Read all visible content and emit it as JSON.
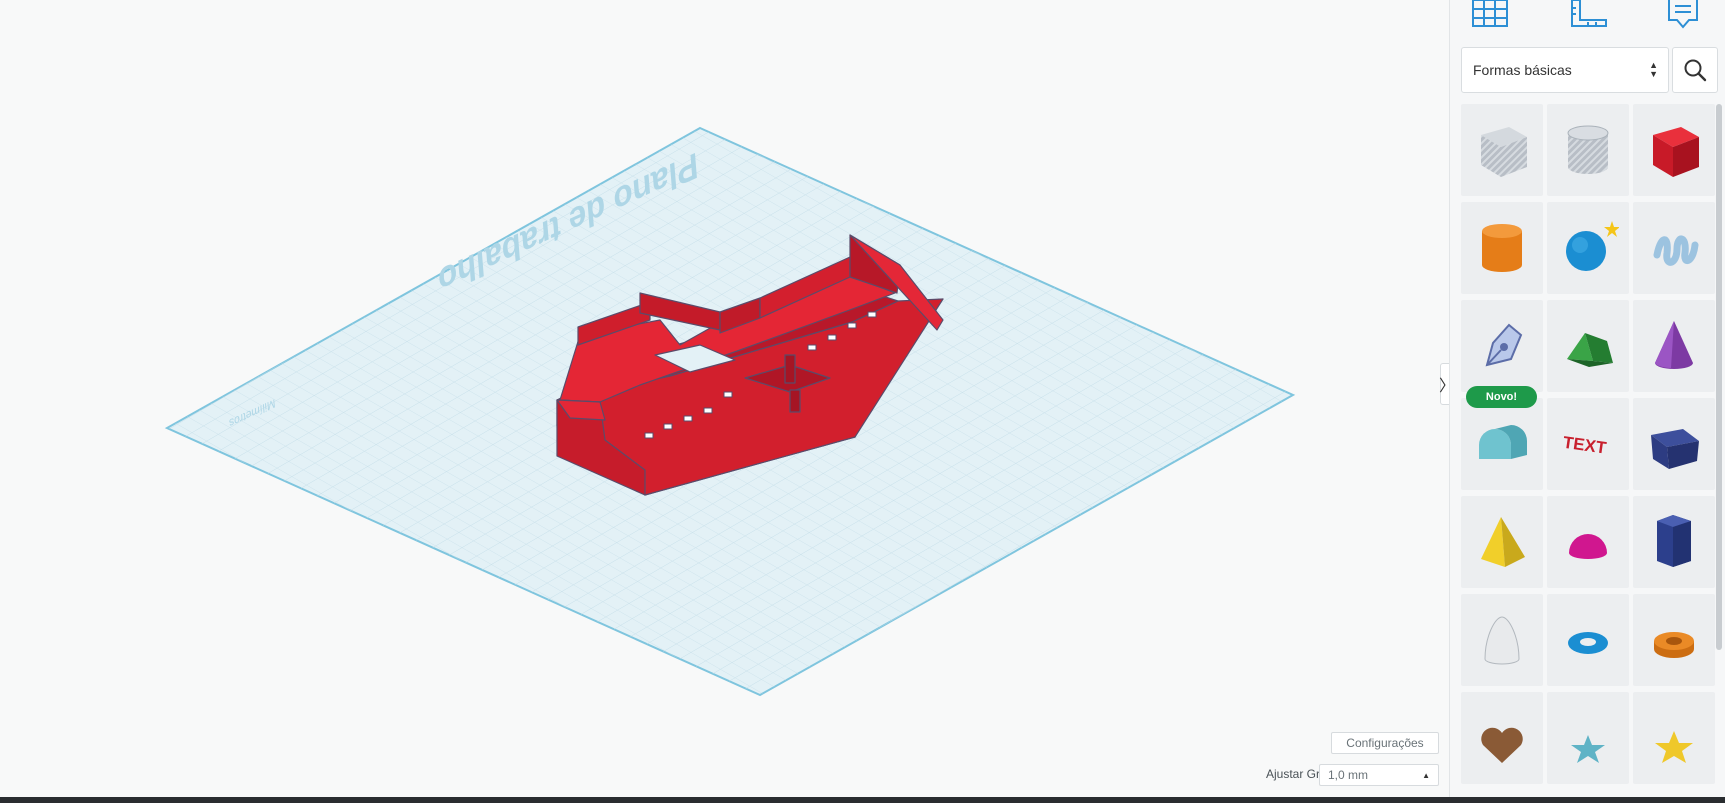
{
  "workplane": {
    "title": "Plano de trabalho",
    "units": "Milímetros"
  },
  "settings": {
    "config_label": "Configurações",
    "grid_label": "Ajustar Grade",
    "grid_value": "1,0 mm"
  },
  "panel": {
    "toggle_glyph": "〉",
    "category": "Formas básicas",
    "new_badge": "Novo!",
    "shapes": [
      {
        "name": "box-hole",
        "icon": "striped-box-icon"
      },
      {
        "name": "cylinder-hole",
        "icon": "striped-cylinder-icon"
      },
      {
        "name": "box",
        "icon": "red-box-icon"
      },
      {
        "name": "cylinder",
        "icon": "orange-cylinder-icon"
      },
      {
        "name": "sphere",
        "icon": "blue-sphere-icon"
      },
      {
        "name": "scribble",
        "icon": "scribble-icon"
      },
      {
        "name": "shape-generator",
        "icon": "pen-icon"
      },
      {
        "name": "roof",
        "icon": "green-roof-icon"
      },
      {
        "name": "cone",
        "icon": "purple-cone-icon"
      },
      {
        "name": "round-roof",
        "icon": "round-roof-icon"
      },
      {
        "name": "text",
        "icon": "text-3d-icon"
      },
      {
        "name": "wedge",
        "icon": "blue-wedge-icon"
      },
      {
        "name": "pyramid",
        "icon": "yellow-pyramid-icon"
      },
      {
        "name": "half-sphere",
        "icon": "magenta-half-sphere-icon"
      },
      {
        "name": "polygon",
        "icon": "blue-polygon-icon"
      },
      {
        "name": "paraboloid",
        "icon": "white-paraboloid-icon"
      },
      {
        "name": "torus",
        "icon": "blue-torus-icon"
      },
      {
        "name": "tube",
        "icon": "orange-tube-icon"
      },
      {
        "name": "heart",
        "icon": "brown-heart-icon"
      },
      {
        "name": "star",
        "icon": "teal-star-icon"
      },
      {
        "name": "star-yellow",
        "icon": "yellow-star-icon"
      }
    ]
  },
  "colors": {
    "model_red": "#d51f2c",
    "plane": "#e3f1f6",
    "accent_blue": "#2d8fd5"
  }
}
